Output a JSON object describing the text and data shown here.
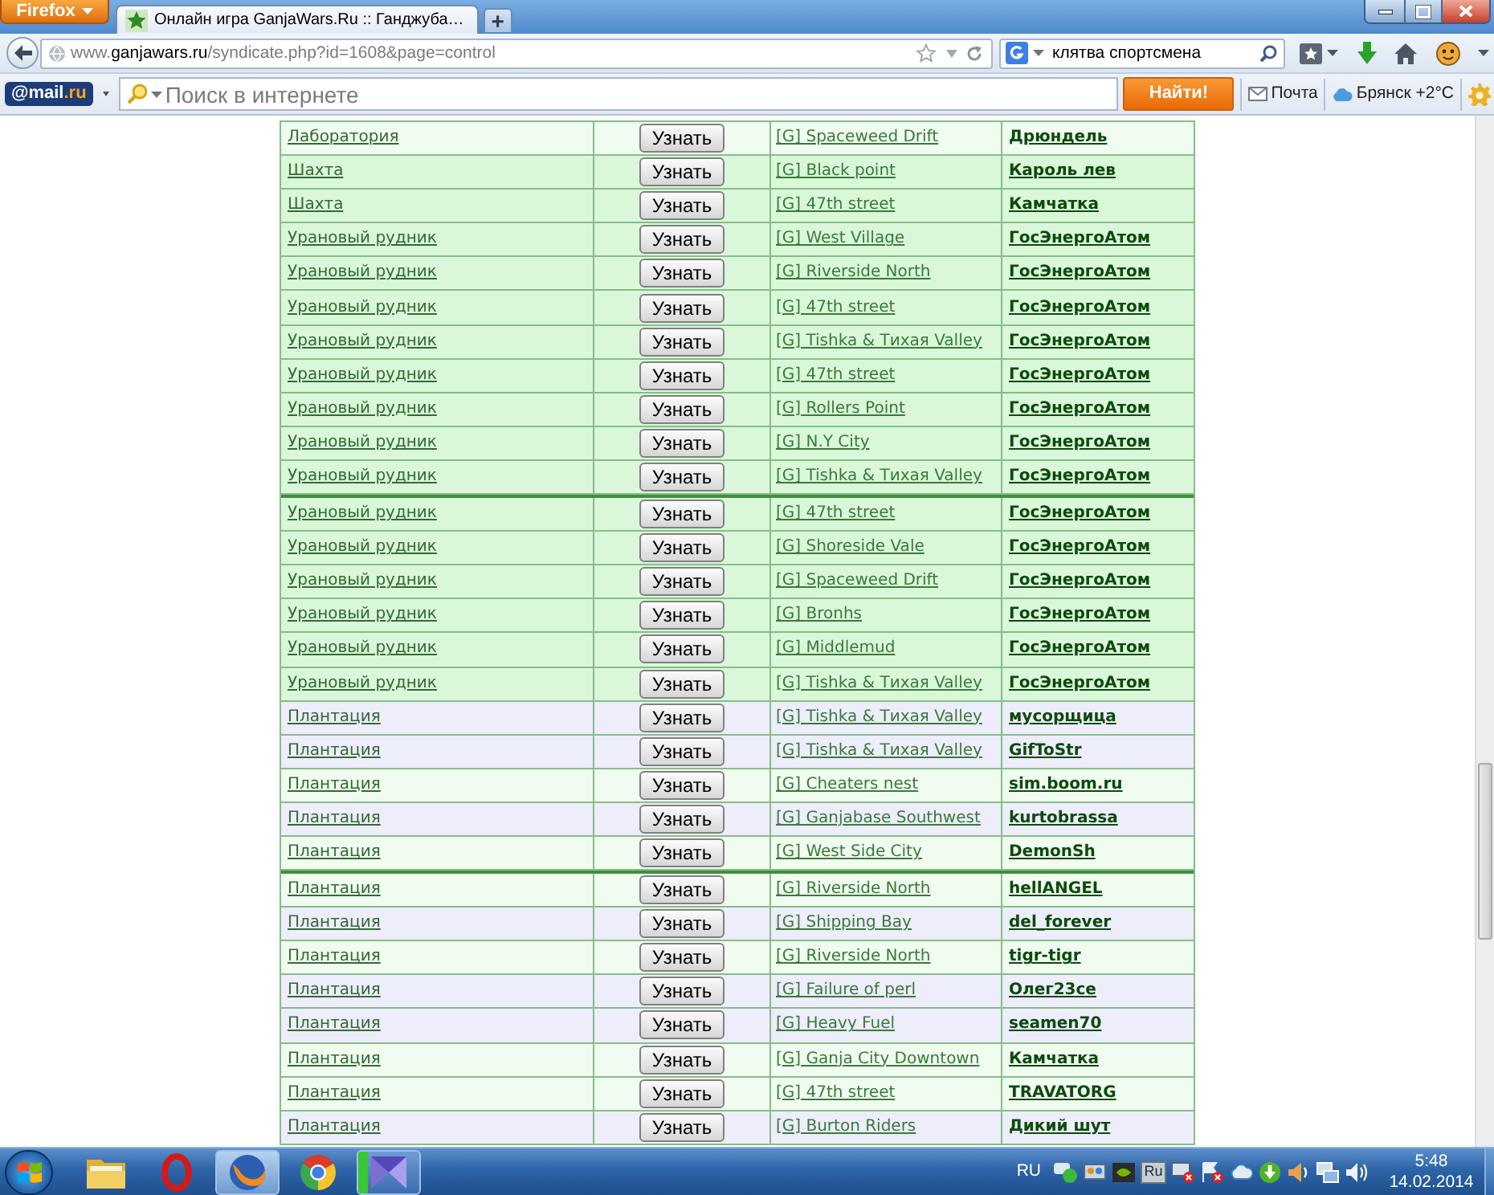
{
  "browser": {
    "menu_button": "Firefox",
    "tabs": [
      {
        "title": "Онлайн игра GanjaWars.Ru :: Ганджуба…",
        "selected": true
      }
    ],
    "new_tab_button": "+",
    "address": {
      "prefix": "www.",
      "domain": "ganjawars.ru",
      "path": "/syndicate.php?id=1608&page=control"
    },
    "search_value": "клятва спортсмена"
  },
  "mail_toolbar": {
    "logo_main": "@mail",
    "logo_domain": ".ru",
    "search_placeholder": "Поиск в интернете",
    "search_button": "Найти!",
    "mail_link": "Почта",
    "weather": "Брянск +2°C"
  },
  "table": {
    "groups": [
      {
        "rows": [
          {
            "building": "Лаборатория",
            "action": "Узнать",
            "sector": "[G] Spaceweed Drift",
            "owner": "Дрюндель",
            "color": "#f0fcf0"
          },
          {
            "building": "Шахта",
            "action": "Узнать",
            "sector": "[G] Black point",
            "owner": "Кароль лев",
            "color": "#daf7da"
          },
          {
            "building": "Шахта",
            "action": "Узнать",
            "sector": "[G] 47th street",
            "owner": "Камчатка",
            "color": "#daf7da"
          },
          {
            "building": "Урановый рудник",
            "action": "Узнать",
            "sector": "[G] West Village",
            "owner": "ГосЭнергоАтом",
            "color": "#daf7da"
          },
          {
            "building": "Урановый рудник",
            "action": "Узнать",
            "sector": "[G] Riverside North",
            "owner": "ГосЭнергоАтом",
            "color": "#daf7da"
          },
          {
            "building": "Урановый рудник",
            "action": "Узнать",
            "sector": "[G] 47th street",
            "owner": "ГосЭнергоАтом",
            "color": "#daf7da"
          },
          {
            "building": "Урановый рудник",
            "action": "Узнать",
            "sector": "[G] Tishka & Тихая Valley",
            "owner": "ГосЭнергоАтом",
            "color": "#daf7da"
          },
          {
            "building": "Урановый рудник",
            "action": "Узнать",
            "sector": "[G] 47th street",
            "owner": "ГосЭнергоАтом",
            "color": "#daf7da"
          },
          {
            "building": "Урановый рудник",
            "action": "Узнать",
            "sector": "[G] Rollers Point",
            "owner": "ГосЭнергоАтом",
            "color": "#daf7da"
          },
          {
            "building": "Урановый рудник",
            "action": "Узнать",
            "sector": "[G] N.Y City",
            "owner": "ГосЭнергоАтом",
            "color": "#daf7da"
          },
          {
            "building": "Урановый рудник",
            "action": "Узнать",
            "sector": "[G] Tishka & Тихая Valley",
            "owner": "ГосЭнергоАтом",
            "color": "#daf7da"
          }
        ]
      },
      {
        "rows": [
          {
            "building": "Урановый рудник",
            "action": "Узнать",
            "sector": "[G] 47th street",
            "owner": "ГосЭнергоАтом",
            "color": "#daf7da"
          },
          {
            "building": "Урановый рудник",
            "action": "Узнать",
            "sector": "[G] Shoreside Vale",
            "owner": "ГосЭнергоАтом",
            "color": "#daf7da"
          },
          {
            "building": "Урановый рудник",
            "action": "Узнать",
            "sector": "[G] Spaceweed Drift",
            "owner": "ГосЭнергоАтом",
            "color": "#daf7da"
          },
          {
            "building": "Урановый рудник",
            "action": "Узнать",
            "sector": "[G] Bronhs",
            "owner": "ГосЭнергоАтом",
            "color": "#daf7da"
          },
          {
            "building": "Урановый рудник",
            "action": "Узнать",
            "sector": "[G] Middlemud",
            "owner": "ГосЭнергоАтом",
            "color": "#daf7da"
          },
          {
            "building": "Урановый рудник",
            "action": "Узнать",
            "sector": "[G] Tishka & Тихая Valley",
            "owner": "ГосЭнергоАтом",
            "color": "#daf7da"
          },
          {
            "building": "Плантация",
            "action": "Узнать",
            "sector": "[G] Tishka & Тихая Valley",
            "owner": "мусорщица",
            "color": "#ededfb"
          },
          {
            "building": "Плантация",
            "action": "Узнать",
            "sector": "[G] Tishka & Тихая Valley",
            "owner": "GifToStr",
            "color": "#ededfb"
          },
          {
            "building": "Плантация",
            "action": "Узнать",
            "sector": "[G] Cheaters nest",
            "owner": "sim.boom.ru",
            "color": "#f0fcf0"
          },
          {
            "building": "Плантация",
            "action": "Узнать",
            "sector": "[G] Ganjabase Southwest",
            "owner": "kurtobrassa",
            "color": "#ededfb"
          },
          {
            "building": "Плантация",
            "action": "Узнать",
            "sector": "[G] West Side City",
            "owner": "DemonSh",
            "color": "#f0fcf0"
          }
        ]
      },
      {
        "rows": [
          {
            "building": "Плантация",
            "action": "Узнать",
            "sector": "[G] Riverside North",
            "owner": "hellANGEL",
            "color": "#f0fcf0"
          },
          {
            "building": "Плантация",
            "action": "Узнать",
            "sector": "[G] Shipping Bay",
            "owner": "del_forever",
            "color": "#ededfb"
          },
          {
            "building": "Плантация",
            "action": "Узнать",
            "sector": "[G] Riverside North",
            "owner": "tigr-tigr",
            "color": "#f0fcf0"
          },
          {
            "building": "Плантация",
            "action": "Узнать",
            "sector": "[G] Failure of perl",
            "owner": "Олег23се",
            "color": "#ededfb"
          },
          {
            "building": "Плантация",
            "action": "Узнать",
            "sector": "[G] Heavy Fuel",
            "owner": "seamen70",
            "color": "#ededfb"
          },
          {
            "building": "Плантация",
            "action": "Узнать",
            "sector": "[G] Ganja City Downtown",
            "owner": "Камчатка",
            "color": "#f0fcf0"
          },
          {
            "building": "Плантация",
            "action": "Узнать",
            "sector": "[G] 47th street",
            "owner": "TRAVATORG",
            "color": "#f0fcf0"
          },
          {
            "building": "Плантация",
            "action": "Узнать",
            "sector": "[G] Burton Riders",
            "owner": "Дикий шут",
            "color": "#ededfb"
          }
        ]
      }
    ]
  },
  "taskbar": {
    "apps": [
      {
        "kind": "folder",
        "running": false,
        "active": false
      },
      {
        "kind": "ring",
        "running": false,
        "active": false
      },
      {
        "kind": "globe",
        "running": true,
        "active": true
      },
      {
        "kind": "segments",
        "running": false,
        "active": false
      },
      {
        "kind": "bowtie",
        "running": true,
        "active": false,
        "level": 0.15
      }
    ],
    "language": "RU",
    "tray_badge": "Ru",
    "time": "5:48",
    "date": "14.02.2014"
  }
}
